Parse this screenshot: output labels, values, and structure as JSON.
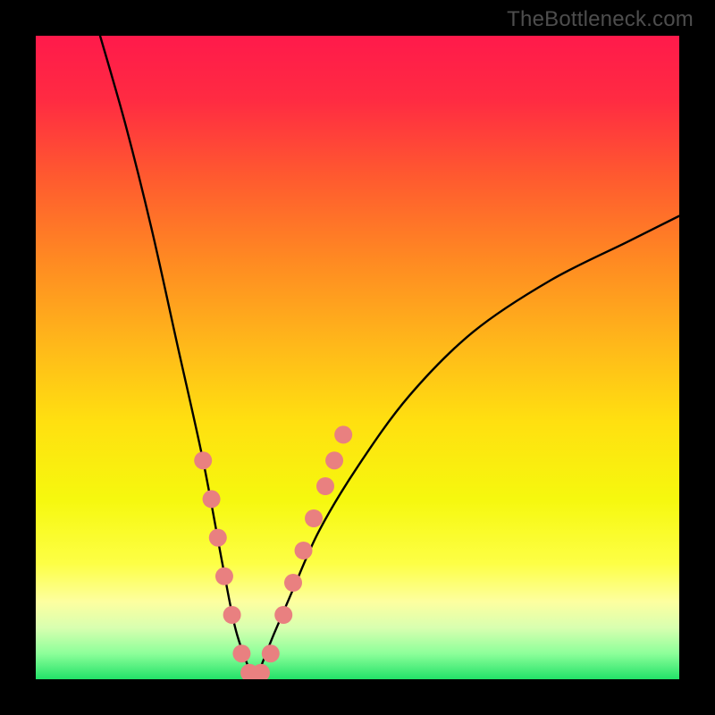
{
  "watermark": {
    "text": "TheBottleneck.com"
  },
  "colors": {
    "gradient_stops": [
      {
        "offset": 0.0,
        "color": "#ff1a4b"
      },
      {
        "offset": 0.1,
        "color": "#ff2b42"
      },
      {
        "offset": 0.22,
        "color": "#ff5a2f"
      },
      {
        "offset": 0.35,
        "color": "#ff8a22"
      },
      {
        "offset": 0.48,
        "color": "#ffb81a"
      },
      {
        "offset": 0.6,
        "color": "#ffe010"
      },
      {
        "offset": 0.72,
        "color": "#f6f80e"
      },
      {
        "offset": 0.82,
        "color": "#fdff45"
      },
      {
        "offset": 0.88,
        "color": "#fdffa0"
      },
      {
        "offset": 0.92,
        "color": "#d8ffb0"
      },
      {
        "offset": 0.96,
        "color": "#8dff9a"
      },
      {
        "offset": 1.0,
        "color": "#22e268"
      }
    ],
    "curve_stroke": "#000000",
    "marker_fill": "#e98080",
    "frame_bg": "#000000"
  },
  "chart_data": {
    "type": "line",
    "title": "",
    "xlabel": "",
    "ylabel": "",
    "xlim": [
      0,
      100
    ],
    "ylim": [
      0,
      100
    ],
    "curve": {
      "comment": "V-shaped curve; y is bottleneck % (0 at trough ≈ x=34). Left branch steep, right branch gentler and asymptotic.",
      "x": [
        10,
        14,
        18,
        22,
        26,
        29,
        31,
        33,
        34,
        35,
        37,
        40,
        44,
        50,
        58,
        68,
        80,
        92,
        100
      ],
      "y": [
        100,
        86,
        70,
        52,
        34,
        18,
        8,
        2,
        0,
        2,
        7,
        14,
        23,
        33,
        44,
        54,
        62,
        68,
        72
      ]
    },
    "markers": {
      "comment": "pink dots near the trough, clustered on both inner slopes",
      "points": [
        {
          "x": 26.0,
          "y": 34
        },
        {
          "x": 27.3,
          "y": 28
        },
        {
          "x": 28.3,
          "y": 22
        },
        {
          "x": 29.3,
          "y": 16
        },
        {
          "x": 30.5,
          "y": 10
        },
        {
          "x": 32.0,
          "y": 4
        },
        {
          "x": 33.2,
          "y": 1
        },
        {
          "x": 34.0,
          "y": 0
        },
        {
          "x": 35.0,
          "y": 1
        },
        {
          "x": 36.5,
          "y": 4
        },
        {
          "x": 38.5,
          "y": 10
        },
        {
          "x": 40.0,
          "y": 15
        },
        {
          "x": 41.6,
          "y": 20
        },
        {
          "x": 43.2,
          "y": 25
        },
        {
          "x": 45.0,
          "y": 30
        },
        {
          "x": 46.4,
          "y": 34
        },
        {
          "x": 47.8,
          "y": 38
        }
      ]
    }
  }
}
